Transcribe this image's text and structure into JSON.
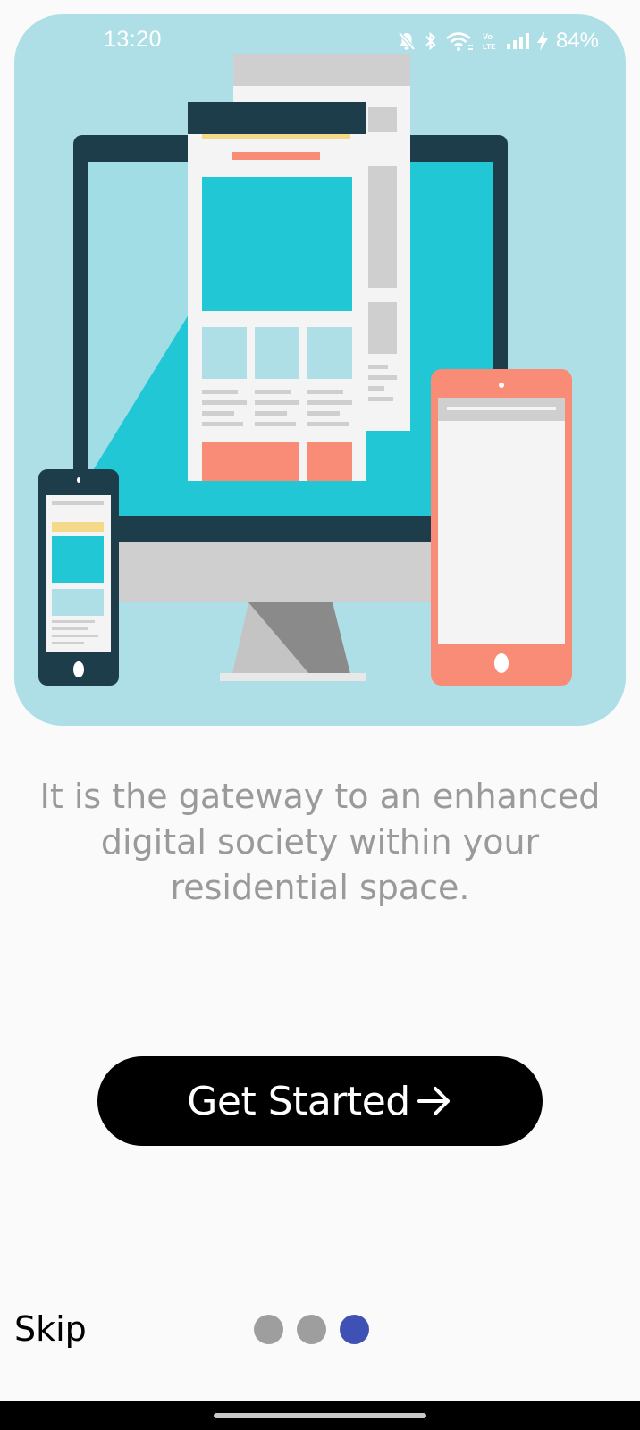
{
  "status_bar": {
    "time": "13:20",
    "battery": "84%",
    "icons": [
      "mute-icon",
      "bluetooth-icon",
      "wifi-icon",
      "volte-icon",
      "signal-icon",
      "charging-icon"
    ]
  },
  "hero": {
    "illustration": "responsive-devices-illustration",
    "colors": {
      "background": "#aedfe6",
      "dark": "#1e3d4b",
      "cyan": "#22c7d6",
      "coral": "#f98c76",
      "paper": "#f4f4f4",
      "gray": "#cfcfcf"
    }
  },
  "message": {
    "text": "It is the gateway to an enhanced digital society within your residential space."
  },
  "cta": {
    "label": "Get Started",
    "icon": "arrow-right-icon"
  },
  "footer": {
    "skip_label": "Skip",
    "pages": {
      "total": 3,
      "current": 3
    },
    "active_color": "#3f51b5",
    "inactive_color": "#9e9e9e"
  }
}
